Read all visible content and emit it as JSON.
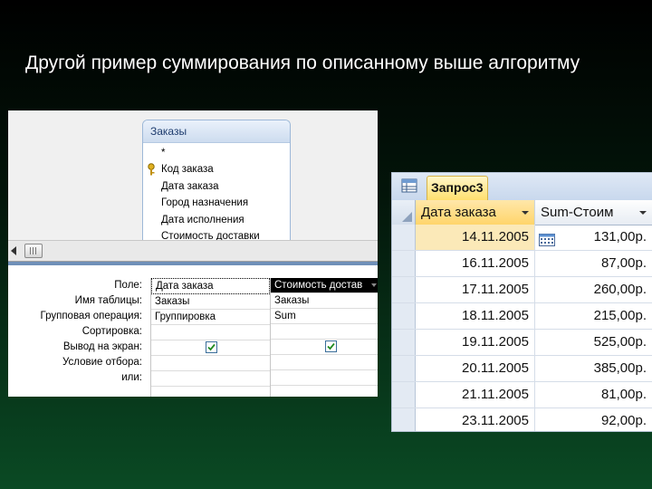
{
  "slide": {
    "title": "Другой пример суммирования по описанному выше алгоритму"
  },
  "designer": {
    "table": {
      "name": "Заказы",
      "fields": [
        "*",
        "Код заказа",
        "Дата заказа",
        "Город назначения",
        "Дата исполнения",
        "Стоимость доставки"
      ],
      "key_field_index": 1
    },
    "row_labels": [
      "Поле:",
      "Имя таблицы:",
      "Групповая операция:",
      "Сортировка:",
      "Вывод на экран:",
      "Условие отбора:",
      "или:"
    ],
    "columns": [
      {
        "field": "Дата заказа",
        "table": "Заказы",
        "group": "Группировка",
        "sort": "",
        "show": true,
        "criteria": "",
        "or": ""
      },
      {
        "field": "Стоимость достав",
        "table": "Заказы",
        "group": "Sum",
        "sort": "",
        "show": true,
        "criteria": "",
        "or": ""
      }
    ]
  },
  "result": {
    "tab_label": "Запрос3",
    "headers": [
      "Дата заказа",
      "Sum-Стоим"
    ],
    "rows": [
      {
        "date": "14.11.2005",
        "sum": "131,00р."
      },
      {
        "date": "16.11.2005",
        "sum": "87,00р."
      },
      {
        "date": "17.11.2005",
        "sum": "260,00р."
      },
      {
        "date": "18.11.2005",
        "sum": "215,00р."
      },
      {
        "date": "19.11.2005",
        "sum": "525,00р."
      },
      {
        "date": "20.11.2005",
        "sum": "385,00р."
      },
      {
        "date": "21.11.2005",
        "sum": "81,00р."
      },
      {
        "date": "23.11.2005",
        "sum": "92,00р."
      }
    ]
  },
  "colors": {
    "accent_active": "#ffd56b",
    "grid_border": "#6f8fb8"
  }
}
